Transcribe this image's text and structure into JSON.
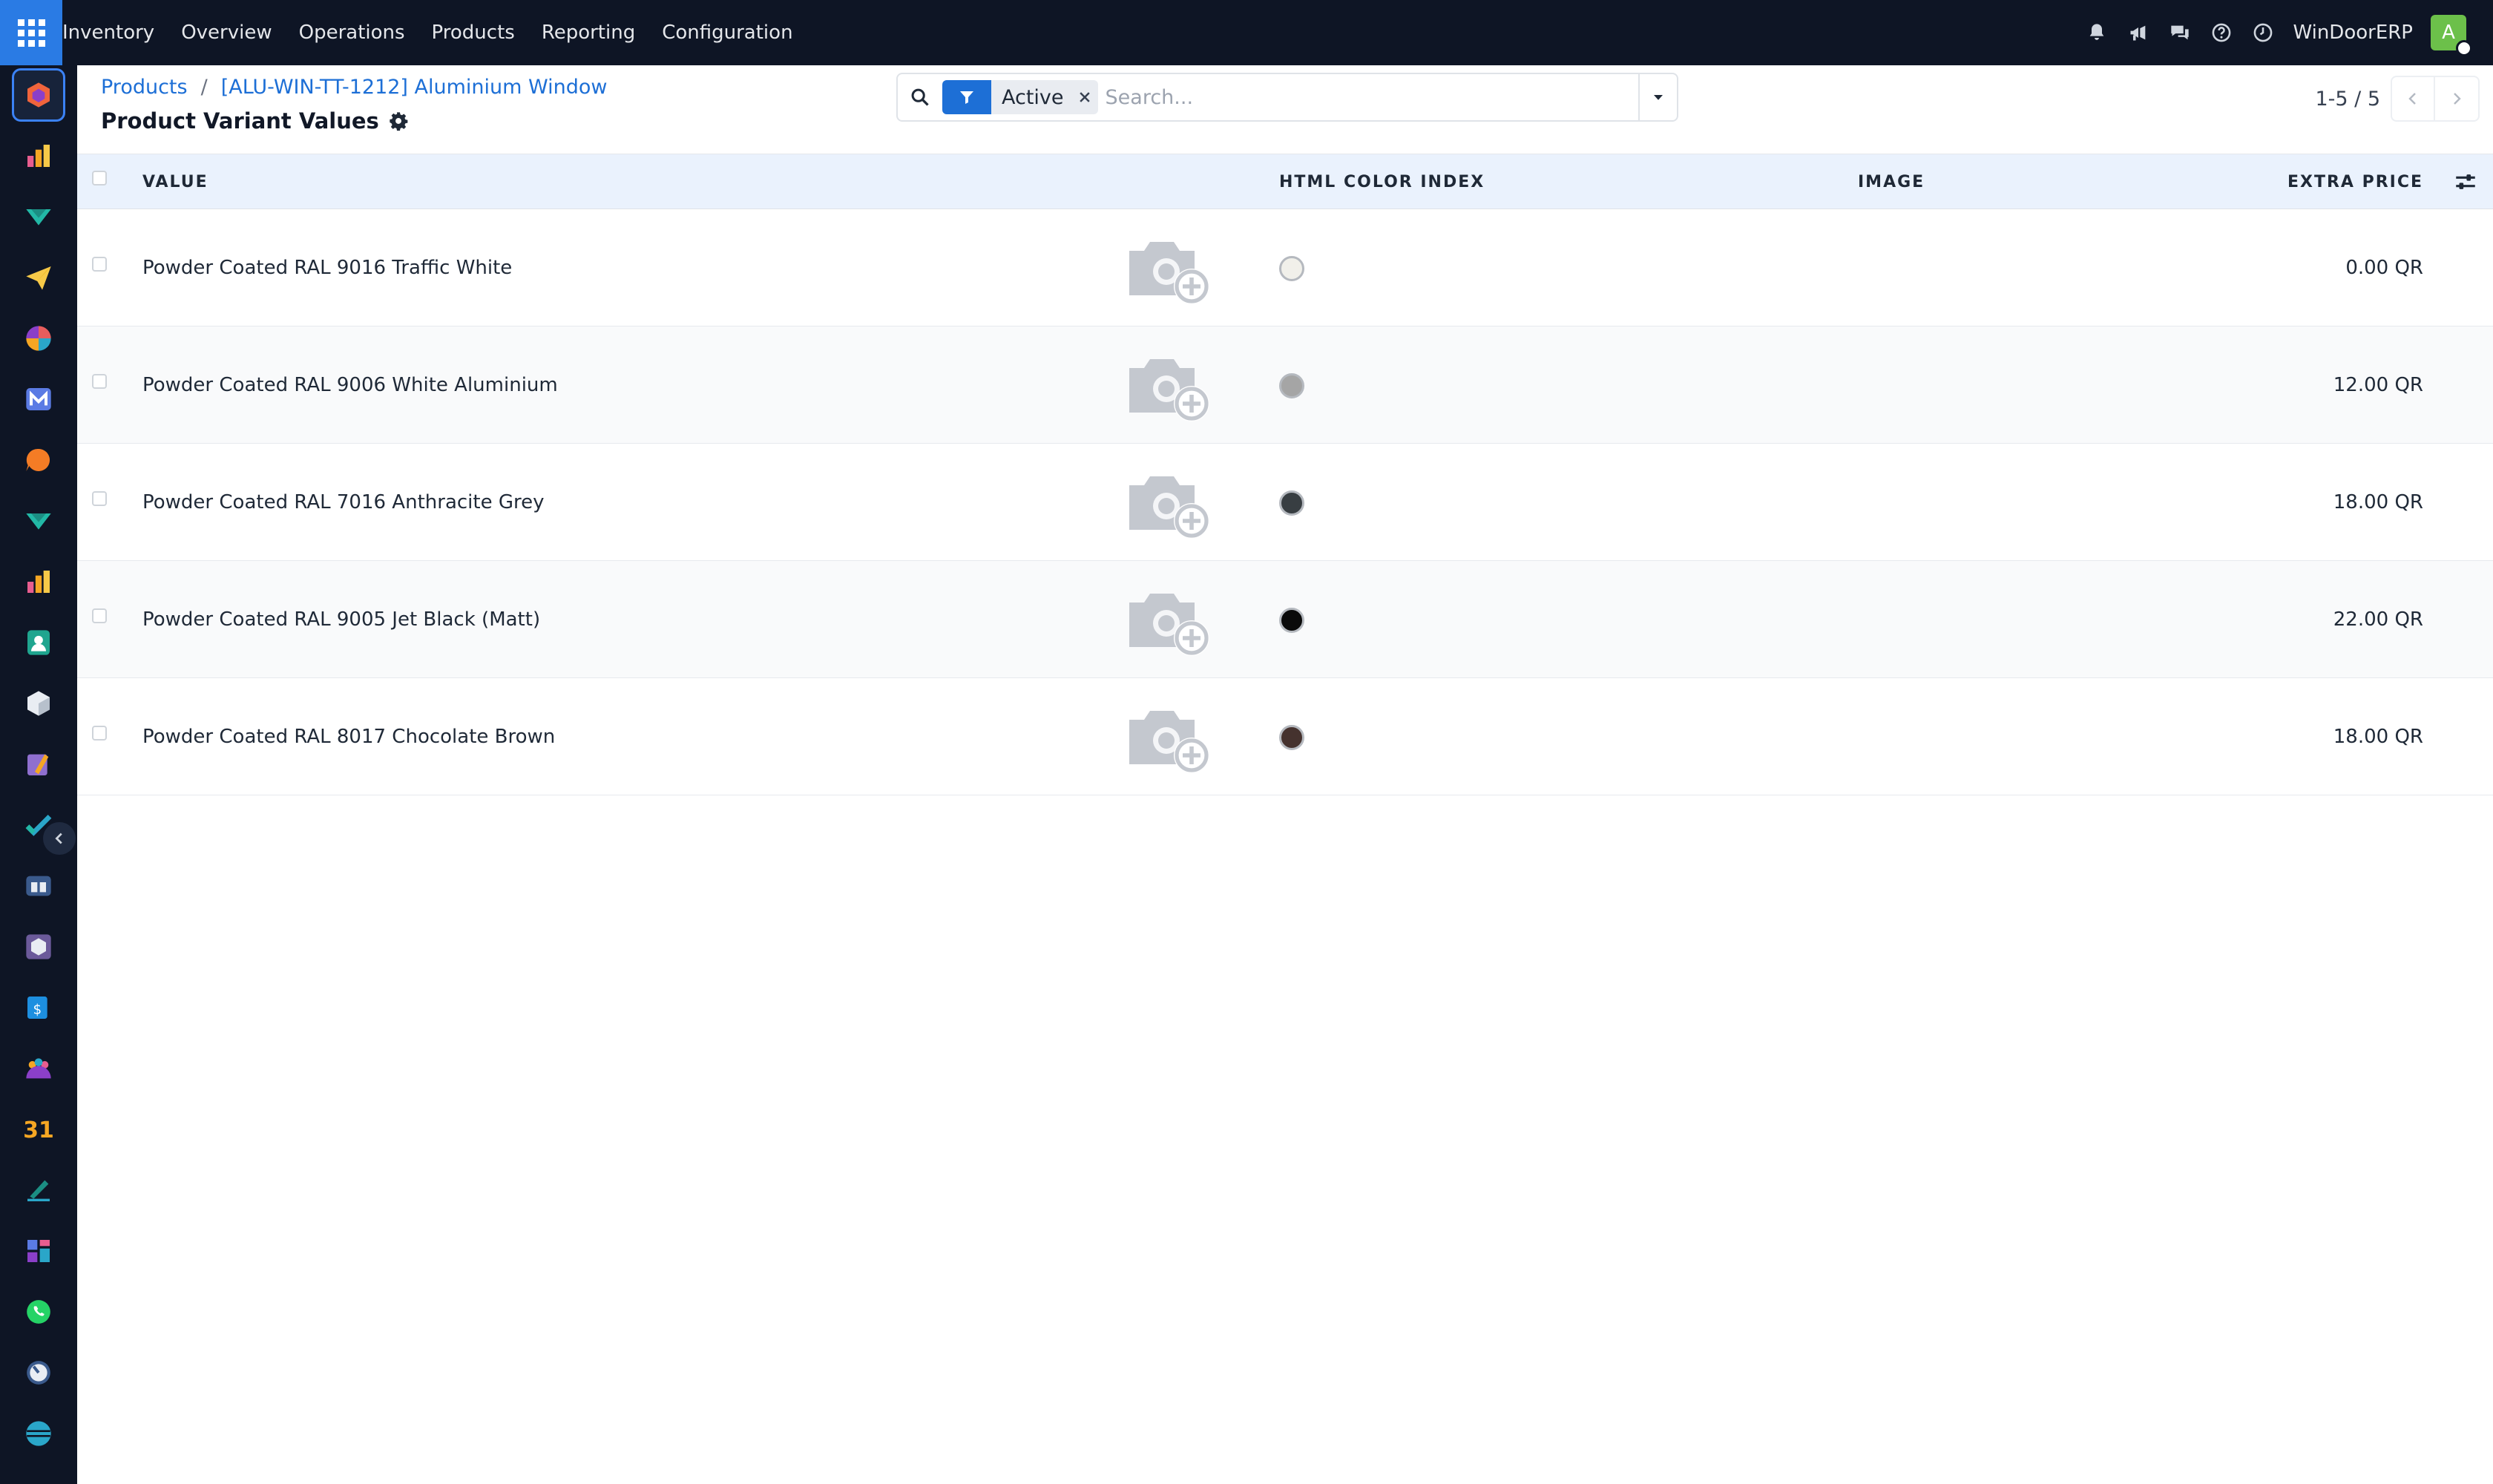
{
  "navbar": {
    "app_name": "Inventory",
    "menu": [
      "Overview",
      "Operations",
      "Products",
      "Reporting",
      "Configuration"
    ],
    "company": "WinDoorERP",
    "user_initial": "A",
    "icons": [
      "bell-icon",
      "megaphone-icon",
      "chat-icon",
      "help-icon",
      "clock-icon"
    ]
  },
  "rail": {
    "apps": [
      "inventory",
      "reporting",
      "accounting",
      "email-marketing",
      "discuss",
      "mail",
      "live-chat",
      "accounting-2",
      "reports",
      "contacts",
      "product",
      "documents",
      "project",
      "knowledge",
      "barcode",
      "invoicing",
      "employees",
      "calendar",
      "sign",
      "dashboards",
      "whatsapp",
      "timesheets",
      "website"
    ],
    "calendar_label": "31",
    "active_index": 0
  },
  "breadcrumb": {
    "items": [
      "Products",
      "[ALU-WIN-TT-1212] Aluminium Window"
    ],
    "separator": "/"
  },
  "page": {
    "title": "Product Variant Values"
  },
  "search": {
    "facet": "Active",
    "placeholder": "Search..."
  },
  "pager": {
    "value": "1-5 / 5"
  },
  "table": {
    "columns": {
      "value": "VALUE",
      "color": "HTML COLOR INDEX",
      "image": "IMAGE",
      "extra_price": "EXTRA PRICE"
    },
    "rows": [
      {
        "value": "Powder Coated RAL 9016 Traffic White",
        "color": "#F1F0EA",
        "extra_price": "0.00 QR"
      },
      {
        "value": "Powder Coated RAL 9006 White Aluminium",
        "color": "#A5A5A5",
        "extra_price": "12.00 QR"
      },
      {
        "value": "Powder Coated RAL 7016 Anthracite Grey",
        "color": "#383E42",
        "extra_price": "18.00 QR"
      },
      {
        "value": "Powder Coated RAL 9005 Jet Black (Matt)",
        "color": "#0A0A0A",
        "extra_price": "22.00 QR"
      },
      {
        "value": "Powder Coated RAL 8017 Chocolate Brown",
        "color": "#45322E",
        "extra_price": "18.00 QR"
      }
    ]
  },
  "colors": {
    "navbar_bg": "#0E1525",
    "accent": "#1D6FD6",
    "apps_button": "#2A7BE4",
    "header_bg": "#EAF2FD",
    "avatar": "#6CC04A"
  }
}
